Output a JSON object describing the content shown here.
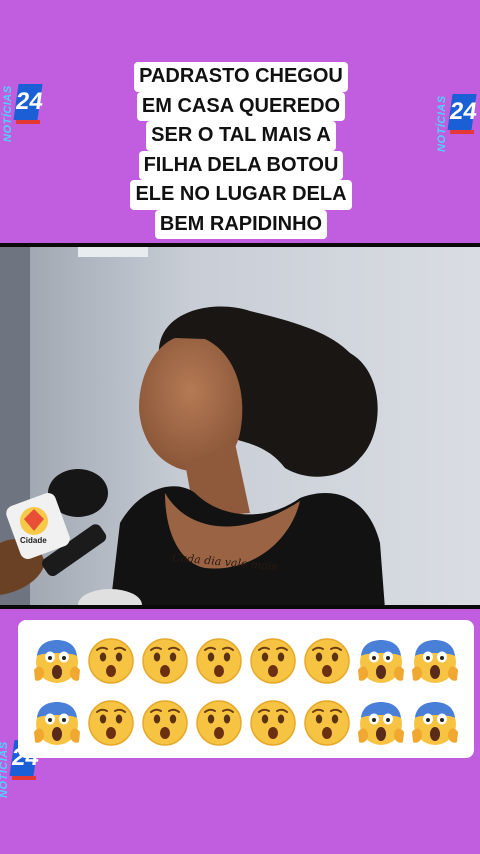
{
  "branding": {
    "logo_word": "NOTÍCIAS",
    "logo_number": "24",
    "colors": {
      "background": "#c15ddf",
      "logo_word": "#4fd2ff",
      "logo_box": "#1b5fd6",
      "logo_stripe": "#e53935"
    }
  },
  "headline": {
    "lines": [
      "PADRASTO CHEGOU",
      "EM CASA QUEREDO",
      "SER O TAL MAIS A",
      "FILHA DELA BOTOU",
      "ELE NO LUGAR DELA",
      "BEM RAPIDINHO"
    ]
  },
  "video": {
    "microphone_logo": "Cidade",
    "tattoo_text": "Cada dia vale mais"
  },
  "reactions": {
    "row1": [
      "scream-emoji",
      "hushed-emoji",
      "hushed-emoji",
      "hushed-emoji",
      "hushed-emoji",
      "hushed-emoji",
      "scream-emoji",
      "scream-emoji"
    ],
    "row2": [
      "scream-emoji",
      "hushed-emoji",
      "hushed-emoji",
      "hushed-emoji",
      "hushed-emoji",
      "hushed-emoji",
      "scream-emoji",
      "scream-emoji"
    ]
  }
}
